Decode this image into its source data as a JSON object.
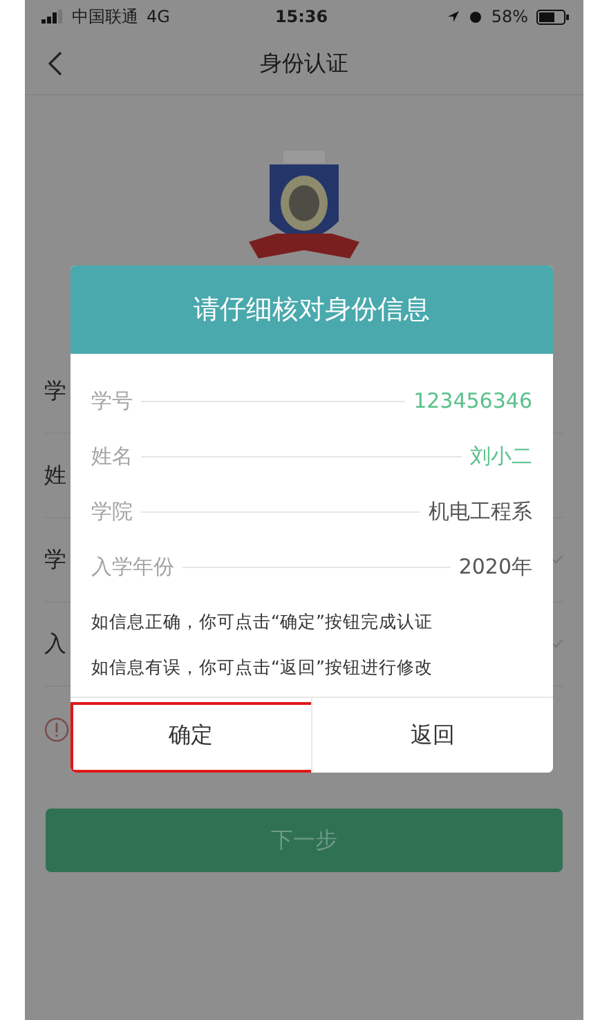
{
  "status_bar": {
    "carrier": "中国联通",
    "network": "4G",
    "time": "15:36",
    "battery": "58%"
  },
  "nav": {
    "title": "身份认证"
  },
  "form_rows": [
    {
      "label": "学",
      "kind": "text"
    },
    {
      "label": "姓",
      "kind": "text"
    },
    {
      "label": "学",
      "kind": "select"
    },
    {
      "label": "入",
      "kind": "select"
    }
  ],
  "next_button": {
    "label": "下一步"
  },
  "dialog": {
    "title": "请仔细核对身份信息",
    "fields": [
      {
        "label": "学号",
        "value": "123456346",
        "highlighted": true
      },
      {
        "label": "姓名",
        "value": "刘小二",
        "highlighted": true
      },
      {
        "label": "学院",
        "value": "机电工程系",
        "highlighted": false
      },
      {
        "label": "入学年份",
        "value": "2020年",
        "highlighted": false
      }
    ],
    "notes": [
      "如信息正确，你可点击“确定”按钮完成认证",
      "如信息有误，你可点击“返回”按钮进行修改"
    ],
    "buttons": [
      {
        "label": "确定",
        "marked": true
      },
      {
        "label": "返回",
        "marked": false
      }
    ]
  }
}
